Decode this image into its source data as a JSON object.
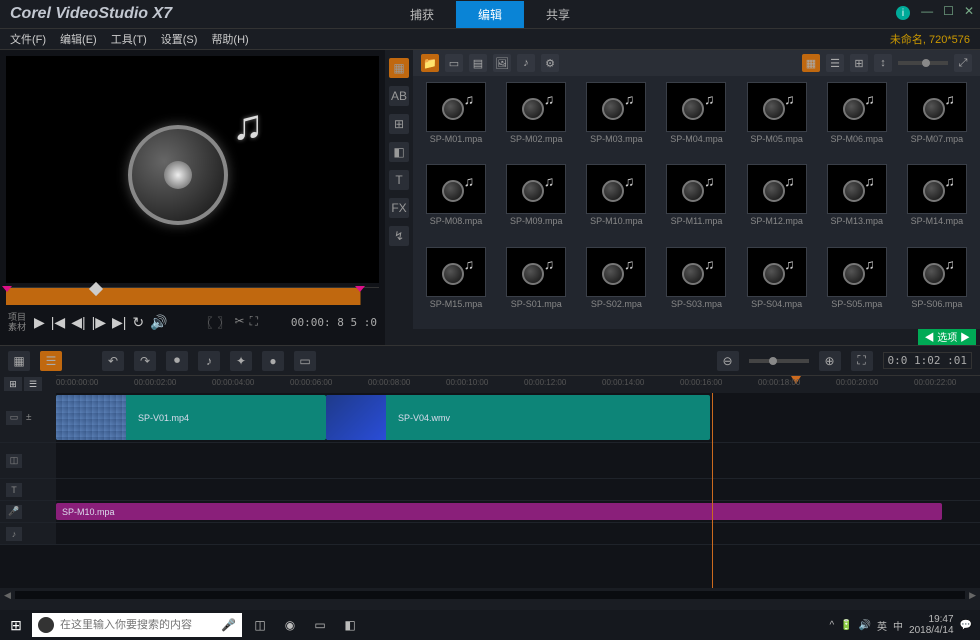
{
  "app": {
    "title": "Corel VideoStudio X7"
  },
  "tabs": {
    "capture": "捕获",
    "edit": "编辑",
    "share": "共享"
  },
  "window_controls": {
    "min": "—",
    "max": "☐",
    "close": "✕"
  },
  "menubar": {
    "file": "文件(F)",
    "edit": "编辑(E)",
    "tools": "工具(T)",
    "settings": "设置(S)",
    "help": "帮助(H)",
    "project_info": "未命名, 720*576"
  },
  "preview": {
    "mode1": "项目",
    "mode2": "素材",
    "timecode": "00:00: 8 5 :0"
  },
  "library": {
    "options_label": "选项",
    "items": [
      {
        "name": "SP-M01.mpa"
      },
      {
        "name": "SP-M02.mpa"
      },
      {
        "name": "SP-M03.mpa"
      },
      {
        "name": "SP-M04.mpa"
      },
      {
        "name": "SP-M05.mpa"
      },
      {
        "name": "SP-M06.mpa"
      },
      {
        "name": "SP-M07.mpa"
      },
      {
        "name": "SP-M08.mpa"
      },
      {
        "name": "SP-M09.mpa"
      },
      {
        "name": "SP-M10.mpa"
      },
      {
        "name": "SP-M11.mpa"
      },
      {
        "name": "SP-M12.mpa"
      },
      {
        "name": "SP-M13.mpa"
      },
      {
        "name": "SP-M14.mpa"
      },
      {
        "name": "SP-M15.mpa"
      },
      {
        "name": "SP-S01.mpa"
      },
      {
        "name": "SP-S02.mpa"
      },
      {
        "name": "SP-S03.mpa"
      },
      {
        "name": "SP-S04.mpa"
      },
      {
        "name": "SP-S05.mpa"
      },
      {
        "name": "SP-S06.mpa"
      }
    ]
  },
  "timeline": {
    "timecode": "0:0 1:02 :01",
    "ruler": [
      "00:00:00:00",
      "00:00:02:00",
      "00:00:04:00",
      "00:00:06:00",
      "00:00:08:00",
      "00:00:10:00",
      "00:00:12:00",
      "00:00:14:00",
      "00:00:16:00",
      "00:00:18:00",
      "00:00:20:00",
      "00:00:22:00"
    ],
    "clip1": "SP-V01.mp4",
    "clip2": "SP-V04.wmv",
    "clip3": "SP-M10.mpa"
  },
  "taskbar": {
    "search_placeholder": "在这里输入你要搜索的内容",
    "tray": {
      "ime": "英",
      "zh": "中",
      "time": "19:47",
      "date": "2018/4/14"
    }
  }
}
